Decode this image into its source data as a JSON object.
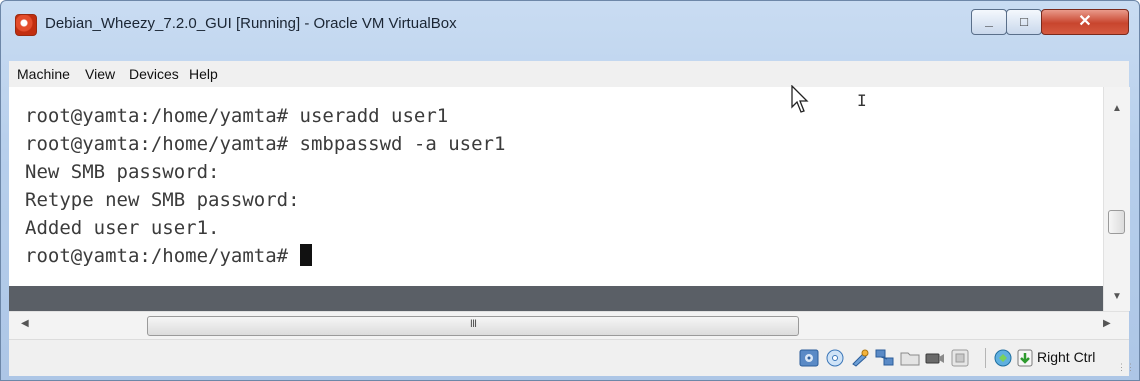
{
  "window": {
    "title": "Debian_Wheezy_7.2.0_GUI [Running] - Oracle VM VirtualBox"
  },
  "menu": [
    "Machine",
    "View",
    "Devices",
    "Help"
  ],
  "terminal": {
    "lines": [
      "root@yamta:/home/yamta# useradd user1",
      "root@yamta:/home/yamta# smbpasswd -a user1",
      "New SMB password:",
      "Retype new SMB password:",
      "Added user user1.",
      "root@yamta:/home/yamta# "
    ]
  },
  "scrollbar": {
    "grip": "III"
  },
  "statusbar": {
    "icons": [
      "hard-disk-icon",
      "optical-drive-icon",
      "usb-icon",
      "network-icon",
      "shared-folders-icon",
      "video-capture-icon",
      "guest-additions-icon",
      "mouse-integration-icon",
      "host-key-icon"
    ],
    "host_key": "Right Ctrl"
  },
  "colors": {
    "terminal_bg": "#ffffff",
    "terminal_text": "#3b3b3b",
    "vm_border": "#5a5f66",
    "titlebar": "#b7cfec",
    "close_button": "#c8452e"
  }
}
